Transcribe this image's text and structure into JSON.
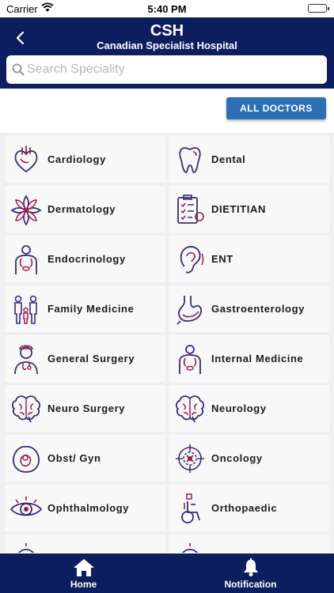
{
  "status_bar": {
    "carrier": "Carrier",
    "time": "5:40 PM"
  },
  "header": {
    "title": "CSH",
    "subtitle": "Canadian Specialist Hospital",
    "search_placeholder": "Search Speciality"
  },
  "all_doctors_label": "ALL DOCTORS",
  "colors": {
    "navy": "#0c1e5e",
    "button_blue": "#2d6fb7",
    "icon_purple": "#3a2a7a",
    "icon_red": "#9c1d4b"
  },
  "specialities": [
    {
      "label": "Cardiology",
      "icon": "heart-icon"
    },
    {
      "label": "Dental",
      "icon": "tooth-icon"
    },
    {
      "label": "Dermatology",
      "icon": "lotus-icon"
    },
    {
      "label": "DIETITIAN",
      "icon": "diet-chart-icon"
    },
    {
      "label": "Endocrinology",
      "icon": "body-organs-icon"
    },
    {
      "label": "ENT",
      "icon": "ear-icon"
    },
    {
      "label": "Family Medicine",
      "icon": "family-icon"
    },
    {
      "label": "Gastroenterology",
      "icon": "stomach-icon"
    },
    {
      "label": "General Surgery",
      "icon": "doctor-icon"
    },
    {
      "label": "Internal Medicine",
      "icon": "body-organs-icon"
    },
    {
      "label": "Neuro Surgery",
      "icon": "brain-icon"
    },
    {
      "label": "Neurology",
      "icon": "brain-icon"
    },
    {
      "label": "Obst/ Gyn",
      "icon": "womb-icon"
    },
    {
      "label": "Oncology",
      "icon": "cell-target-icon"
    },
    {
      "label": "Ophthalmology",
      "icon": "eye-icon"
    },
    {
      "label": "Orthopaedic",
      "icon": "wheelchair-icon"
    },
    {
      "label": "",
      "icon": "partial-icon"
    },
    {
      "label": "",
      "icon": "partial-icon"
    }
  ],
  "bottom_nav": {
    "home": "Home",
    "notification": "Notification"
  }
}
